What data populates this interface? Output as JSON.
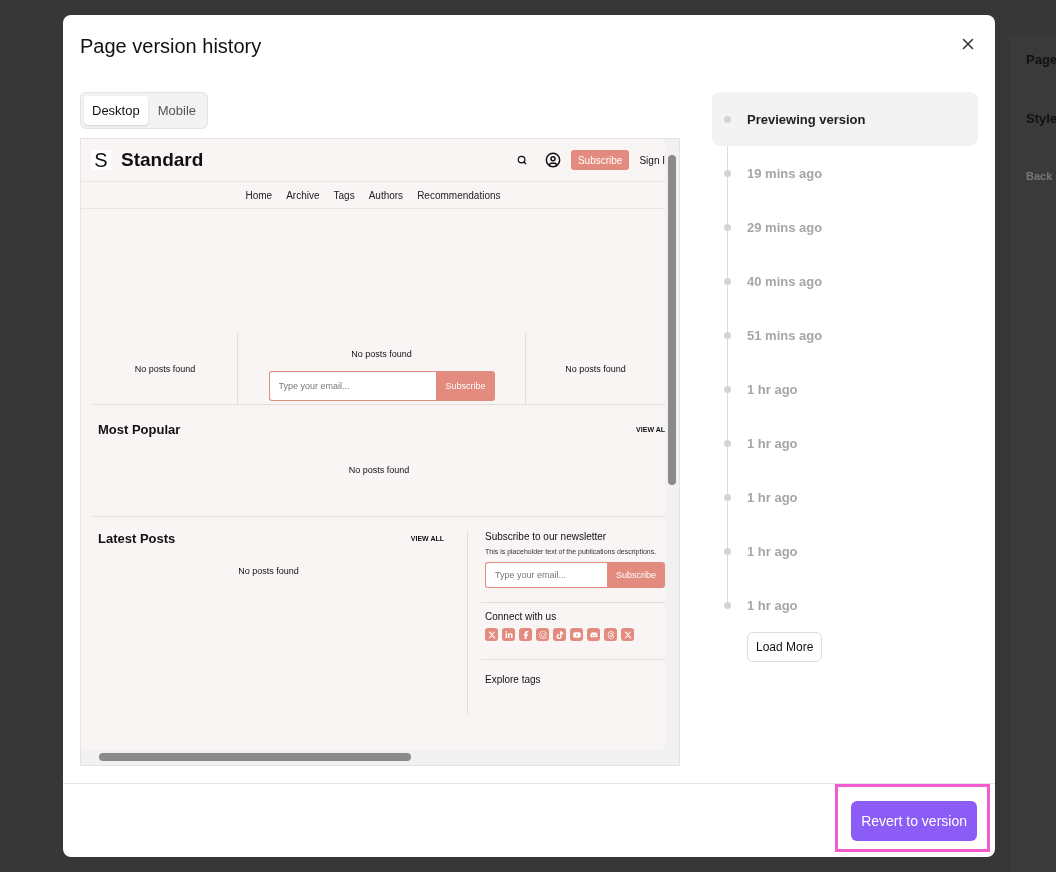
{
  "background": {
    "side_labels": [
      "Page",
      "Style",
      "Back"
    ]
  },
  "dialog": {
    "title": "Page version history",
    "view_tabs": [
      {
        "label": "Desktop",
        "selected": true
      },
      {
        "label": "Mobile",
        "selected": false
      }
    ],
    "preview": {
      "site_logo": "S",
      "site_name": "Standard",
      "subscribe_button": "Subscribe",
      "sign_in": "Sign I",
      "nav": [
        "Home",
        "Archive",
        "Tags",
        "Authors",
        "Recommendations"
      ],
      "featured_columns": [
        "No posts found",
        "No posts found",
        "No posts found"
      ],
      "hero_email": {
        "placeholder": "Type your email...",
        "button": "Subscribe"
      },
      "most_popular": {
        "title": "Most Popular",
        "view_all": "VIEW AL",
        "empty_text": "No posts found"
      },
      "latest_posts": {
        "title": "Latest Posts",
        "view_all": "VIEW ALL",
        "empty_text": "No posts found"
      },
      "newsletter": {
        "title": "Subscribe to our newsletter",
        "description": "This is placeholder text of the publications descriptions.",
        "placeholder": "Type your email...",
        "button": "Subscribe"
      },
      "connect_title": "Connect with us",
      "explore_tags": "Explore tags"
    },
    "versions": [
      {
        "label": "Previewing version",
        "selected": true
      },
      {
        "label": "19 mins ago",
        "selected": false
      },
      {
        "label": "29 mins ago",
        "selected": false
      },
      {
        "label": "40 mins ago",
        "selected": false
      },
      {
        "label": "51 mins ago",
        "selected": false
      },
      {
        "label": "1 hr ago",
        "selected": false
      },
      {
        "label": "1 hr ago",
        "selected": false
      },
      {
        "label": "1 hr ago",
        "selected": false
      },
      {
        "label": "1 hr ago",
        "selected": false
      },
      {
        "label": "1 hr ago",
        "selected": false
      }
    ],
    "load_more": "Load More",
    "revert_button": "Revert to version"
  }
}
